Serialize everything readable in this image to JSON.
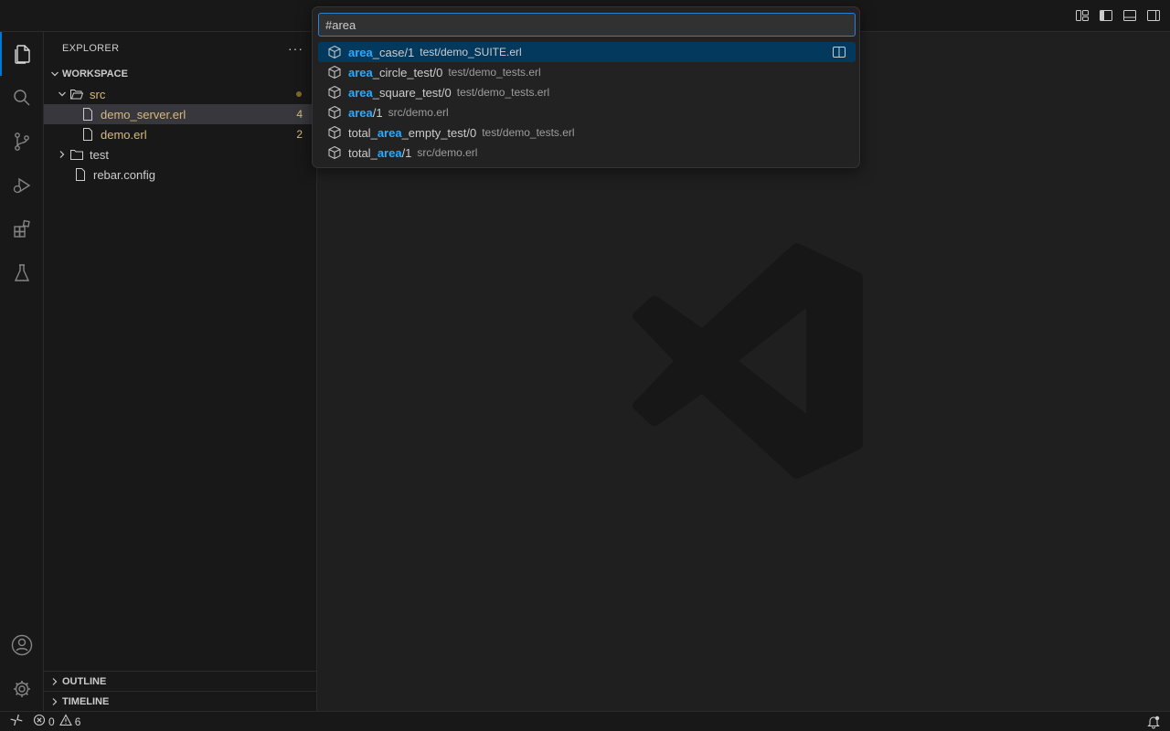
{
  "titlebar": {
    "layout_icons": [
      "customize-layout-icon",
      "toggle-primary-sidebar-icon",
      "toggle-panel-icon",
      "toggle-secondary-sidebar-icon"
    ]
  },
  "activitybar": {
    "items": [
      "explorer-icon",
      "search-icon",
      "source-control-icon",
      "run-debug-icon",
      "extensions-icon",
      "testing-icon"
    ],
    "bottom": [
      "accounts-icon",
      "manage-gear-icon"
    ]
  },
  "sidebar": {
    "title": "EXPLORER",
    "more": "···",
    "workspace": "WORKSPACE",
    "tree": [
      {
        "label": "src",
        "type": "folder",
        "expanded": true,
        "color": "#d7ba7d"
      },
      {
        "label": "demo_server.erl",
        "type": "file",
        "badge": "4",
        "color": "#d7ba7d"
      },
      {
        "label": "demo.erl",
        "type": "file",
        "badge": "2",
        "color": "#d7ba7d"
      },
      {
        "label": "test",
        "type": "folder",
        "expanded": false
      },
      {
        "label": "rebar.config",
        "type": "file"
      }
    ],
    "outline": "OUTLINE",
    "timeline": "TIMELINE"
  },
  "quickpick": {
    "value": "#area",
    "items": [
      {
        "pre": "",
        "match": "area",
        "post": "_case/1",
        "desc": "test/demo_SUITE.erl"
      },
      {
        "pre": "",
        "match": "area",
        "post": "_circle_test/0",
        "desc": "test/demo_tests.erl"
      },
      {
        "pre": "",
        "match": "area",
        "post": "_square_test/0",
        "desc": "test/demo_tests.erl"
      },
      {
        "pre": "",
        "match": "area",
        "post": "/1",
        "desc": "src/demo.erl"
      },
      {
        "pre": "total_",
        "match": "area",
        "post": "_empty_test/0",
        "desc": "test/demo_tests.erl"
      },
      {
        "pre": "total_",
        "match": "area",
        "post": "/1",
        "desc": "src/demo.erl"
      }
    ]
  },
  "statusbar": {
    "errors": "0",
    "warnings": "6"
  },
  "colors": {
    "accent": "#0078d4",
    "highlight": "#2aaaff",
    "modified": "#d7ba7d"
  }
}
